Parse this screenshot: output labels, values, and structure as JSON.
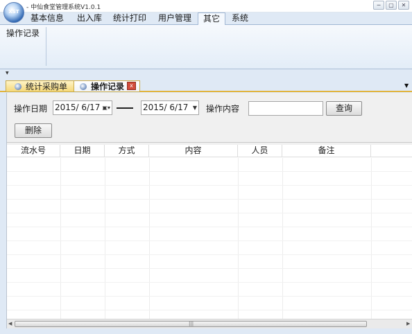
{
  "app": {
    "logo_text": "XST",
    "title": "- 中仙食堂管理系统V1.0.1",
    "window_buttons": [
      "─",
      "▢",
      "✕"
    ]
  },
  "ribbon": {
    "tabs": [
      "基本信息",
      "出入库",
      "统计打印",
      "用户管理",
      "其它",
      "系统"
    ],
    "active_tab": "其它",
    "group_items": [
      "操作记录"
    ]
  },
  "doc_tabs": {
    "tabs": [
      {
        "label": "统计采购单",
        "active": false
      },
      {
        "label": "操作记录",
        "active": true
      }
    ],
    "close_glyph": "x"
  },
  "filter": {
    "date_label": "操作日期",
    "start_date": "2015/ 6/17",
    "end_date": "2015/ 6/17",
    "content_label": "操作内容",
    "content_value": "",
    "query_button": "查询",
    "delete_button": "删除"
  },
  "grid": {
    "columns": [
      "流水号",
      "日期",
      "方式",
      "内容",
      "人员",
      "备注"
    ],
    "rows": []
  },
  "colors": {
    "ribbon_bg": "#dfe9f5",
    "doc_tab_accent": "#e2b43c",
    "close_red": "#d24c3b"
  },
  "icons": {
    "app": "app-logo-icon",
    "tab": "tab-circle-icon",
    "calendar": "calendar-dropdown-icon",
    "dropdown": "chevron-down-icon"
  }
}
